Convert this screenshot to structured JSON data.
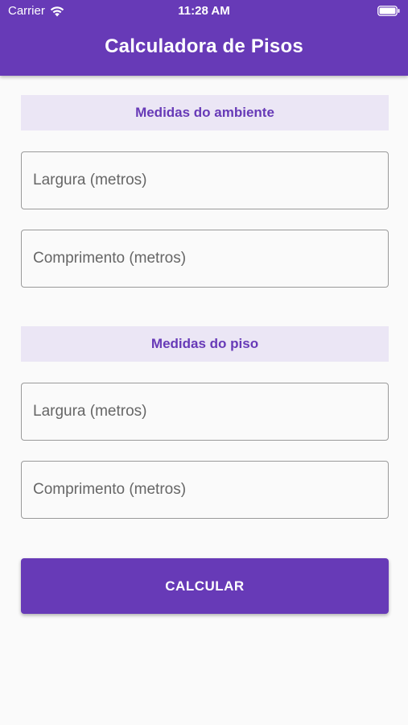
{
  "status_bar": {
    "carrier": "Carrier",
    "time": "11:28 AM",
    "icons": [
      "wifi-icon",
      "battery-icon"
    ]
  },
  "app_bar": {
    "title": "Calculadora de Pisos",
    "color": "#673ab7"
  },
  "room_section": {
    "heading": "Medidas do ambiente",
    "width_placeholder": "Largura (metros)",
    "length_placeholder": "Comprimento (metros)"
  },
  "floor_section": {
    "heading": "Medidas do piso",
    "width_placeholder": "Largura (metros)",
    "length_placeholder": "Comprimento (metros)"
  },
  "actions": {
    "calculate_label": "CALCULAR"
  },
  "colors": {
    "primary": "#673ab7",
    "section_background": "#ebe6f5",
    "page_background": "#fafafa"
  }
}
